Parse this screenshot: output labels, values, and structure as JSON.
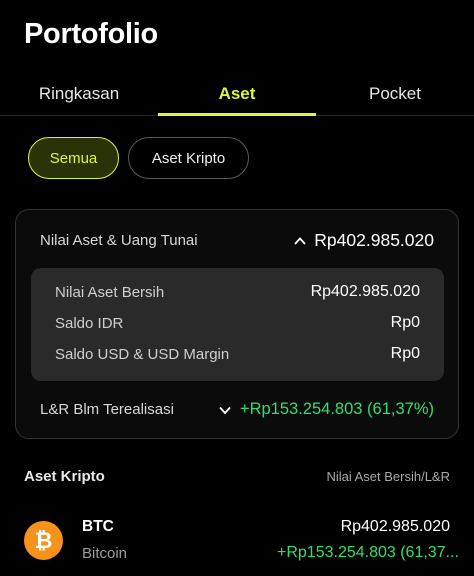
{
  "header": {
    "title": "Portofolio"
  },
  "tabs": [
    {
      "label": "Ringkasan",
      "active": false
    },
    {
      "label": "Aset",
      "active": true
    },
    {
      "label": "Pocket",
      "active": false
    }
  ],
  "filters": [
    {
      "label": "Semua",
      "active": true
    },
    {
      "label": "Aset Kripto",
      "active": false
    }
  ],
  "summary": {
    "total_label": "Nilai Aset & Uang Tunai",
    "total_value": "Rp402.985.020",
    "total_icon": "chevron-up-icon",
    "details": [
      {
        "label": "Nilai Aset Bersih",
        "value": "Rp402.985.020"
      },
      {
        "label": "Saldo IDR",
        "value": "Rp0"
      },
      {
        "label": "Saldo USD & USD Margin",
        "value": "Rp0"
      }
    ],
    "pnl_label": "L&R Blm Terealisasi",
    "pnl_icon": "chevron-down-icon",
    "pnl_value": "+Rp153.254.803 (61,37%)"
  },
  "assets_section": {
    "title": "Aset Kripto",
    "column_label": "Nilai Aset Bersih/L&R",
    "items": [
      {
        "icon": "bitcoin-icon",
        "icon_glyph": "₿",
        "symbol": "BTC",
        "name": "Bitcoin",
        "value": "Rp402.985.020",
        "pnl": "+Rp153.254.803 (61,37..."
      }
    ]
  },
  "colors": {
    "accent": "#d7fa3a",
    "positive": "#2ee06d",
    "bitcoin": "#f7931a",
    "background": "#000000"
  }
}
